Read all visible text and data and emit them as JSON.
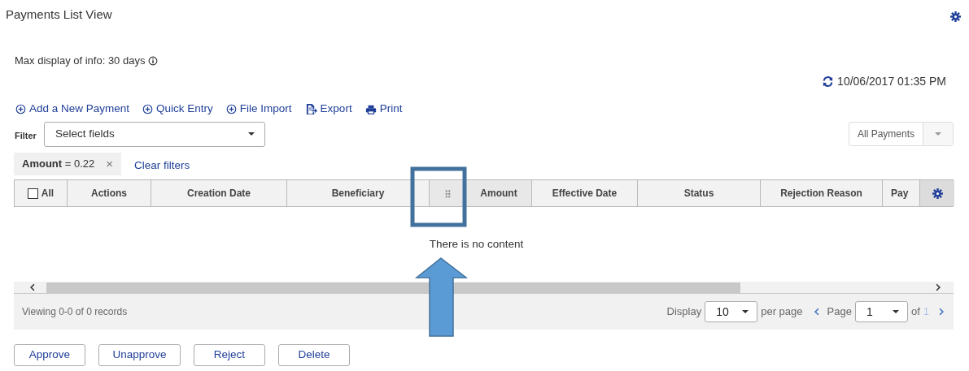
{
  "page": {
    "title": "Payments List View",
    "retention_note": "Max display of info: 30 days",
    "refreshed_at": "10/06/2017 01:35 PM"
  },
  "actions": [
    {
      "label": "Add a New Payment",
      "kind": "add"
    },
    {
      "label": "Quick Entry",
      "kind": "add"
    },
    {
      "label": "File Import",
      "kind": "add"
    },
    {
      "label": "Export",
      "kind": "export"
    },
    {
      "label": "Print",
      "kind": "print"
    }
  ],
  "filter": {
    "label": "Filter",
    "placeholder": "Select fields",
    "view": "All Payments"
  },
  "active_filters": [
    {
      "field": "Amount",
      "expression": "= 0.22",
      "remove": "×"
    }
  ],
  "clear_filters": "Clear filters",
  "table": {
    "columns": [
      {
        "kind": "checkbox",
        "label": "All",
        "checked": false
      },
      {
        "kind": "text",
        "label": "Actions"
      },
      {
        "kind": "text",
        "label": "Creation Date"
      },
      {
        "kind": "text",
        "label": "Beneficiary"
      },
      {
        "kind": "grip"
      },
      {
        "kind": "text",
        "label": "Amount"
      },
      {
        "kind": "text",
        "label": "Effective Date"
      },
      {
        "kind": "text",
        "label": "Status"
      },
      {
        "kind": "text",
        "label": "Rejection Reason"
      },
      {
        "kind": "text",
        "label": "Pay"
      },
      {
        "kind": "settings"
      }
    ],
    "empty_message": "There is no content"
  },
  "footer": {
    "records": "Viewing 0-0 of 0 records",
    "display_label": "Display",
    "page_size": "10",
    "per_page": "per page",
    "page_label": "Page",
    "page": "1",
    "of_label": "of",
    "page_count": "1"
  },
  "buttons": [
    "Approve",
    "Unapprove",
    "Reject",
    "Delete"
  ]
}
